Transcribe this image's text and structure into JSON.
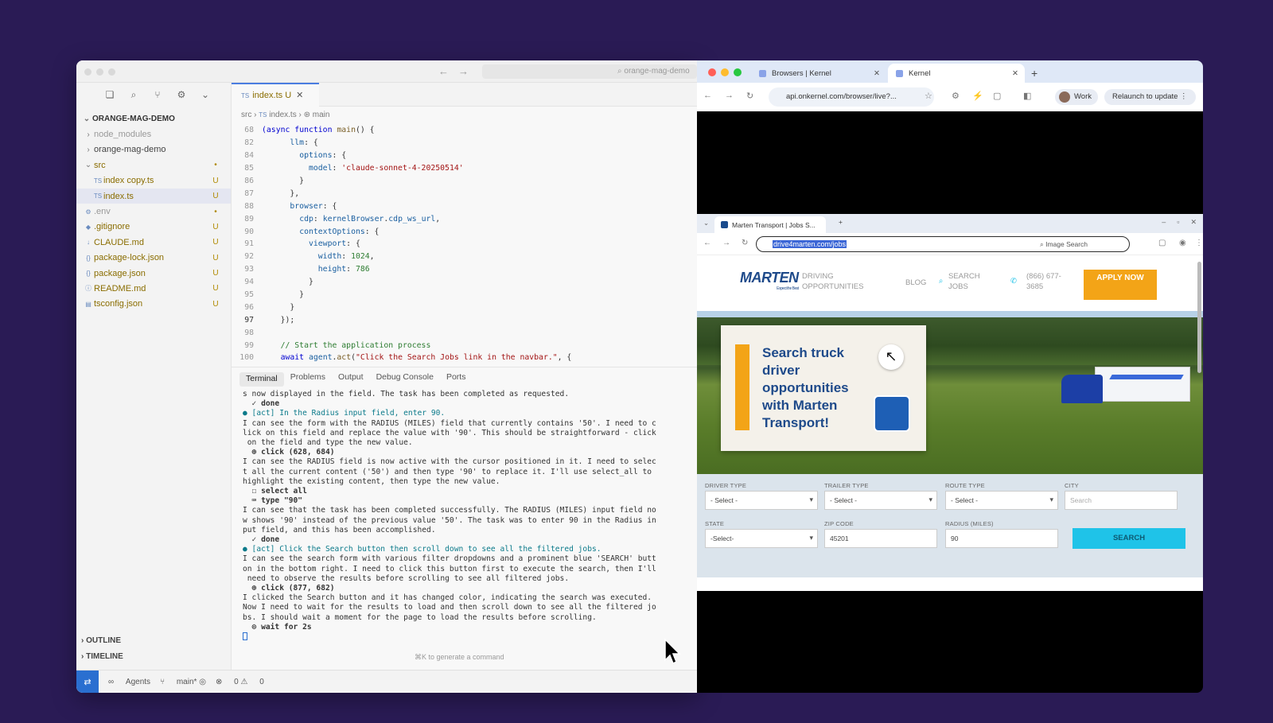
{
  "editor": {
    "search_text": "orange-mag-demo",
    "explorer_title": "ORANGE-MAG-DEMO",
    "tree": [
      {
        "name": "node_modules",
        "status": "",
        "kind": "folder",
        "style": "dim"
      },
      {
        "name": "orange-mag-demo",
        "status": "",
        "kind": "folder",
        "style": ""
      },
      {
        "name": "src",
        "status": "•",
        "kind": "folder-open",
        "style": "mod"
      },
      {
        "name": "index copy.ts",
        "status": "U",
        "kind": "ts",
        "style": "mod"
      },
      {
        "name": "index.ts",
        "status": "U",
        "kind": "ts",
        "style": "mod sel"
      },
      {
        "name": ".env",
        "status": "•",
        "kind": "gear",
        "style": "dim"
      },
      {
        "name": ".gitignore",
        "status": "U",
        "kind": "git",
        "style": "mod"
      },
      {
        "name": "CLAUDE.md",
        "status": "U",
        "kind": "md",
        "style": "mod"
      },
      {
        "name": "package-lock.json",
        "status": "U",
        "kind": "json",
        "style": "mod"
      },
      {
        "name": "package.json",
        "status": "U",
        "kind": "json",
        "style": "mod"
      },
      {
        "name": "README.md",
        "status": "U",
        "kind": "info",
        "style": "mod"
      },
      {
        "name": "tsconfig.json",
        "status": "U",
        "kind": "cfg",
        "style": "mod"
      }
    ],
    "outline_label": "OUTLINE",
    "timeline_label": "TIMELINE",
    "tab": {
      "name": "index.ts",
      "status": "U"
    },
    "breadcrumb": [
      "src",
      "index.ts",
      "main"
    ],
    "code_lines": [
      {
        "n": "68",
        "html": "<span class=\"k\">(async</span> <span class=\"k\">function</span> <span class=\"f\">main</span>() {"
      },
      {
        "n": "82",
        "html": "      <span class=\"p\">llm</span>: {"
      },
      {
        "n": "84",
        "html": "        <span class=\"p\">options</span>: {"
      },
      {
        "n": "85",
        "html": "          <span class=\"p\">model</span>: <span class=\"s\">'claude-sonnet-4-20250514'</span>"
      },
      {
        "n": "86",
        "html": "        }"
      },
      {
        "n": "87",
        "html": "      },"
      },
      {
        "n": "88",
        "html": "      <span class=\"p\">browser</span>: {"
      },
      {
        "n": "89",
        "html": "        <span class=\"p\">cdp</span>: <span class=\"p\">kernelBrowser</span>.<span class=\"p\">cdp_ws_url</span>,"
      },
      {
        "n": "90",
        "html": "        <span class=\"p\">contextOptions</span>: {"
      },
      {
        "n": "91",
        "html": "          <span class=\"p\">viewport</span>: {"
      },
      {
        "n": "92",
        "html": "            <span class=\"p\">width</span>: <span class=\"c\">1024</span>,"
      },
      {
        "n": "93",
        "html": "            <span class=\"p\">height</span>: <span class=\"c\">786</span>"
      },
      {
        "n": "94",
        "html": "          }"
      },
      {
        "n": "95",
        "html": "        }"
      },
      {
        "n": "96",
        "html": "      }"
      },
      {
        "n": "97",
        "html": "    });"
      },
      {
        "n": "98",
        "html": ""
      },
      {
        "n": "99",
        "html": "    <span class=\"c\">// Start the application process</span>"
      },
      {
        "n": "100",
        "html": "    <span class=\"k\">await</span> <span class=\"p\">agent</span>.<span class=\"f\">act</span>(<span class=\"s\">\"Click the Search Jobs link in the navbar.\"</span>, {"
      }
    ],
    "panel_tabs": [
      "Terminal",
      "Problems",
      "Output",
      "Debug Console",
      "Ports"
    ],
    "terminal": [
      {
        "t": "s now displayed in the field. The task has been completed as requested.",
        "c": ""
      },
      {
        "t": "  ✓ done",
        "c": "bold"
      },
      {
        "t": "● [act] In the Radius input field, enter 90.",
        "c": "act"
      },
      {
        "t": "I can see the form with the RADIUS (MILES) field that currently contains '50'. I need to c",
        "c": ""
      },
      {
        "t": "lick on this field and replace the value with '90'. This should be straightforward - click",
        "c": ""
      },
      {
        "t": " on the field and type the new value.",
        "c": ""
      },
      {
        "t": "  ⊕ click (628, 684)",
        "c": "bold"
      },
      {
        "t": "I can see the RADIUS field is now active with the cursor positioned in it. I need to selec",
        "c": ""
      },
      {
        "t": "t all the current content ('50') and then type '90' to replace it. I'll use select_all to",
        "c": ""
      },
      {
        "t": "highlight the existing content, then type the new value.",
        "c": ""
      },
      {
        "t": "  ☐ select all",
        "c": "bold"
      },
      {
        "t": "  ⌨ type \"90\"",
        "c": "bold"
      },
      {
        "t": "I can see that the task has been completed successfully. The RADIUS (MILES) input field no",
        "c": ""
      },
      {
        "t": "w shows '90' instead of the previous value '50'. The task was to enter 90 in the Radius in",
        "c": ""
      },
      {
        "t": "put field, and this has been accomplished.",
        "c": ""
      },
      {
        "t": "  ✓ done",
        "c": "bold"
      },
      {
        "t": "● [act] Click the Search button then scroll down to see all the filtered jobs.",
        "c": "act"
      },
      {
        "t": "I can see the search form with various filter dropdowns and a prominent blue 'SEARCH' butt",
        "c": ""
      },
      {
        "t": "on in the bottom right. I need to click this button first to execute the search, then I'll",
        "c": ""
      },
      {
        "t": " need to observe the results before scrolling to see all filtered jobs.",
        "c": ""
      },
      {
        "t": "  ⊕ click (877, 682)",
        "c": "bold"
      },
      {
        "t": "I clicked the Search button and it has changed color, indicating the search was executed.",
        "c": ""
      },
      {
        "t": "Now I need to wait for the results to load and then scroll down to see all the filtered jo",
        "c": ""
      },
      {
        "t": "bs. I should wait a moment for the page to load the results before scrolling.",
        "c": ""
      },
      {
        "t": "  ⊙ wait for 2s",
        "c": "bold"
      }
    ],
    "hint": "⌘K to generate a command",
    "status": {
      "agents": "Agents",
      "branch": "main*",
      "errors": "0",
      "warnings": "0"
    }
  },
  "browser": {
    "tabs": [
      {
        "label": "Browsers | Kernel"
      },
      {
        "label": "Kernel"
      }
    ],
    "url": "api.onkernel.com/browser/live?...",
    "work_label": "Work",
    "relaunch_label": "Relaunch to update",
    "inner": {
      "tab_label": "Marten Transport | Jobs S...",
      "url": "drive4marten.com/jobs",
      "image_search": "Image Search",
      "logo": "MARTEN",
      "logo_sub": "Expect the Best",
      "nav": {
        "driving": "DRIVING OPPORTUNITIES",
        "blog": "BLOG",
        "search": "SEARCH JOBS",
        "phone": "(866) 677-3685",
        "apply": "APPLY NOW"
      },
      "hero_text": "Search truck driver opportunities with Marten Transport!",
      "form": {
        "driver_type": "DRIVER TYPE",
        "trailer_type": "TRAILER TYPE",
        "route_type": "ROUTE TYPE",
        "city": "CITY",
        "state": "STATE",
        "zip": "ZIP CODE",
        "radius": "RADIUS (MILES)",
        "select1": "- Select -",
        "select2": "- Select -",
        "select3": "- Select -",
        "city_ph": "Search",
        "state_val": "-Select-",
        "zip_val": "45201",
        "radius_val": "90",
        "search": "SEARCH"
      }
    }
  }
}
